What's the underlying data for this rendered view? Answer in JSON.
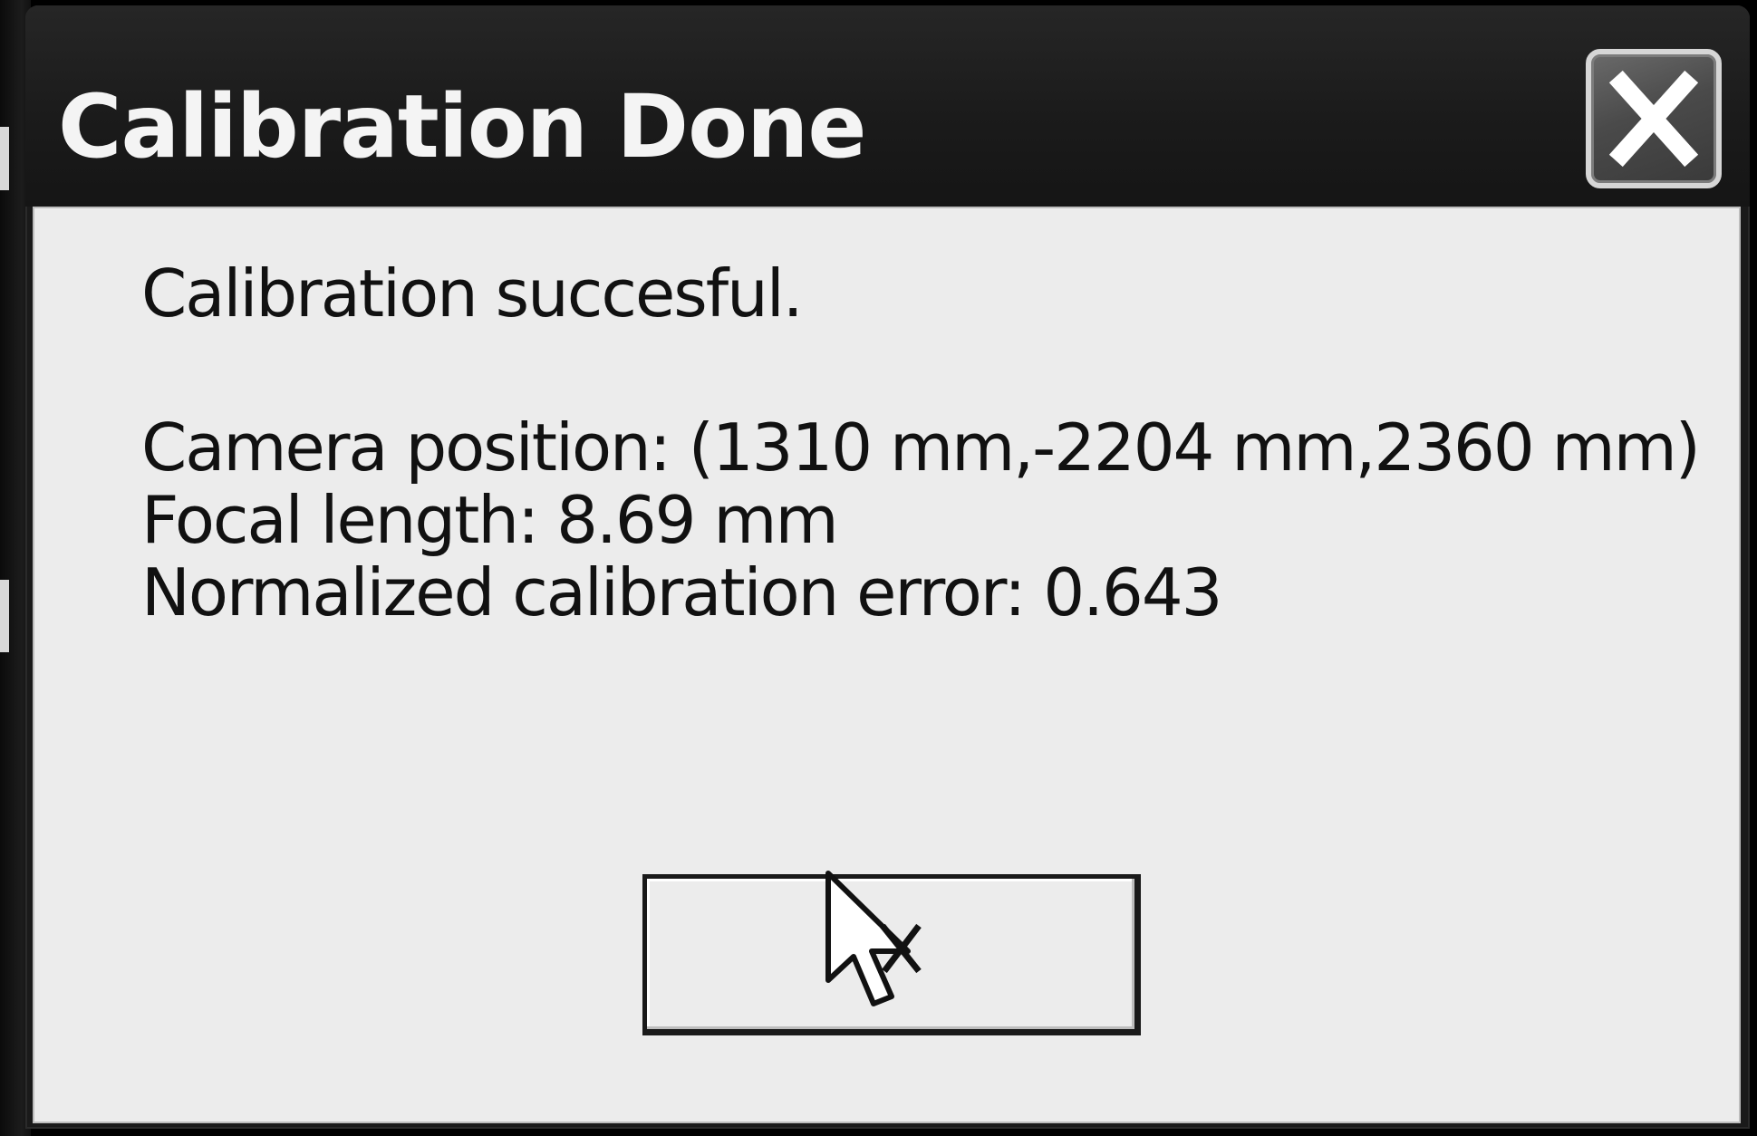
{
  "window": {
    "title": "Calibration Done",
    "close_icon": "close-icon"
  },
  "message": {
    "status": "Calibration succesful.",
    "camera_position": "Camera position: (1310 mm,-2204 mm,2360 mm)",
    "focal_length": "Focal length: 8.69 mm",
    "calibration_error": "Normalized calibration error: 0.643"
  },
  "ok_button": {
    "label": ""
  },
  "cursor": {
    "icon": "mouse-pointer-icon"
  }
}
